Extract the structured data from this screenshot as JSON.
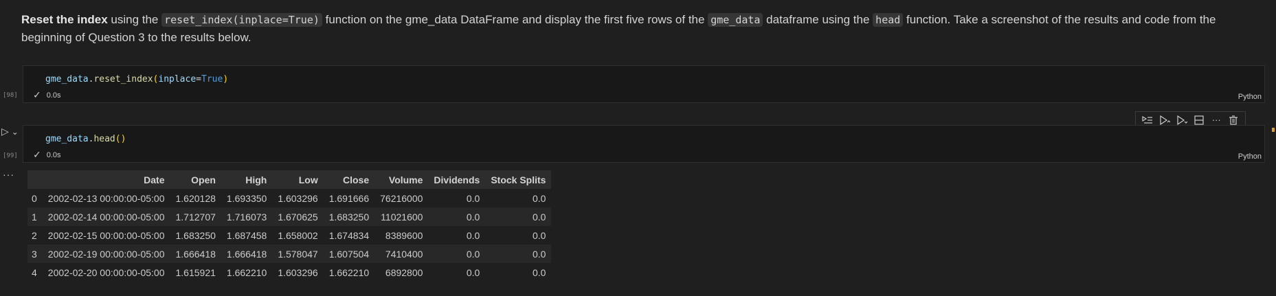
{
  "markdown": {
    "bold": "Reset the index",
    "t1": " using the ",
    "code1": "reset_index(inplace=True)",
    "t2": " function on the gme_data DataFrame and display the first five rows of the ",
    "code2": "gme_data",
    "t3": " dataframe using the ",
    "code3": "head",
    "t4": " function. Take a screenshot of the results and code from the beginning of Question 3 to the results below."
  },
  "cell1": {
    "exec_count": "[98]",
    "code_var": "gme_data",
    "code_dot": ".",
    "code_fn": "reset_index",
    "code_open": "(",
    "code_arg": "inplace",
    "code_eq": "=",
    "code_kw": "True",
    "code_close": ")",
    "status": "0.0s",
    "lang": "Python"
  },
  "cell2": {
    "exec_count": "[99]",
    "code_var": "gme_data",
    "code_dot": ".",
    "code_fn": "head",
    "code_parens": "()",
    "status": "0.0s",
    "lang": "Python"
  },
  "icons": {
    "run": "▷",
    "chevron": "⌄",
    "check": "✓",
    "ellipsis": "···",
    "toolbar": [
      "run-by-line-icon",
      "execute-above-icon",
      "execute-below-icon",
      "split-cell-icon",
      "more-icon",
      "delete-icon"
    ]
  },
  "table": {
    "headers": [
      "",
      "Date",
      "Open",
      "High",
      "Low",
      "Close",
      "Volume",
      "Dividends",
      "Stock Splits"
    ],
    "rows": [
      [
        "0",
        "2002-02-13 00:00:00-05:00",
        "1.620128",
        "1.693350",
        "1.603296",
        "1.691666",
        "76216000",
        "0.0",
        "0.0"
      ],
      [
        "1",
        "2002-02-14 00:00:00-05:00",
        "1.712707",
        "1.716073",
        "1.670625",
        "1.683250",
        "11021600",
        "0.0",
        "0.0"
      ],
      [
        "2",
        "2002-02-15 00:00:00-05:00",
        "1.683250",
        "1.687458",
        "1.658002",
        "1.674834",
        "8389600",
        "0.0",
        "0.0"
      ],
      [
        "3",
        "2002-02-19 00:00:00-05:00",
        "1.666418",
        "1.666418",
        "1.578047",
        "1.607504",
        "7410400",
        "0.0",
        "0.0"
      ],
      [
        "4",
        "2002-02-20 00:00:00-05:00",
        "1.615921",
        "1.662210",
        "1.603296",
        "1.662210",
        "6892800",
        "0.0",
        "0.0"
      ]
    ]
  }
}
